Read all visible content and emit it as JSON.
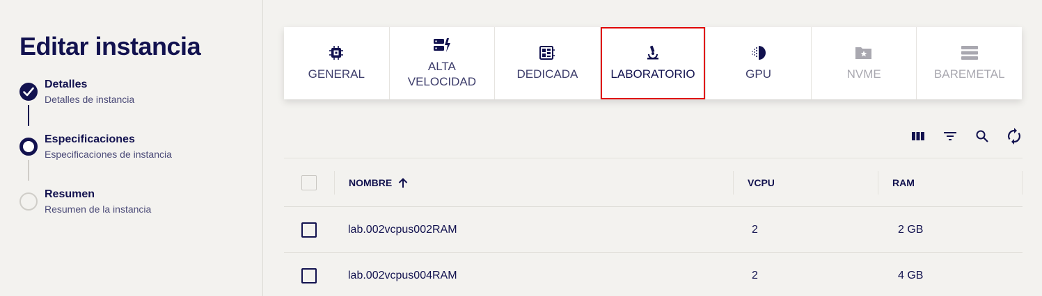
{
  "sidebar": {
    "title": "Editar instancia",
    "steps": [
      {
        "title": "Detalles",
        "subtitle": "Detalles de instancia",
        "state": "done"
      },
      {
        "title": "Especificaciones",
        "subtitle": "Especificaciones de instancia",
        "state": "active"
      },
      {
        "title": "Resumen",
        "subtitle": "Resumen de la instancia",
        "state": "todo"
      }
    ]
  },
  "tabs": [
    {
      "label": "GENERAL",
      "icon": "cpu-chip-icon",
      "state": "enabled"
    },
    {
      "label": "ALTA\nVELOCIDAD",
      "icon": "server-bolt-icon",
      "state": "enabled"
    },
    {
      "label": "DEDICADA",
      "icon": "dedicated-board-icon",
      "state": "enabled"
    },
    {
      "label": "LABORATORIO",
      "icon": "microscope-icon",
      "state": "selected"
    },
    {
      "label": "GPU",
      "icon": "gpu-icon",
      "state": "enabled"
    },
    {
      "label": "NVME",
      "icon": "folder-star-icon",
      "state": "disabled"
    },
    {
      "label": "BAREMETAL",
      "icon": "server-stack-icon",
      "state": "disabled"
    }
  ],
  "toolbar": [
    "columns-icon",
    "filter-icon",
    "search-icon",
    "refresh-icon"
  ],
  "table": {
    "columns": [
      "NOMBRE",
      "VCPU",
      "RAM"
    ],
    "sort": {
      "column": "NOMBRE",
      "direction": "ascending"
    },
    "rows": [
      {
        "name": "lab.002vcpus002RAM",
        "vcpu": "2",
        "ram": "2 GB"
      },
      {
        "name": "lab.002vcpus004RAM",
        "vcpu": "2",
        "ram": "4 GB"
      }
    ]
  },
  "colors": {
    "primary": "#12124f",
    "highlight": "#e00000",
    "background": "#f3f2ef",
    "disabled": "#a9a8b0"
  }
}
